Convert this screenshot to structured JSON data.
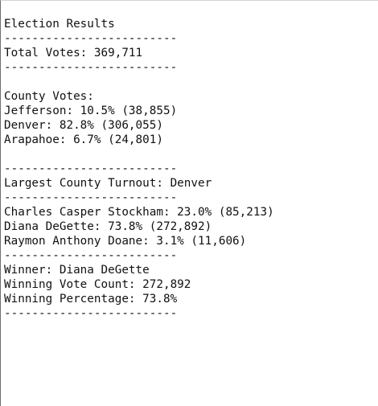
{
  "document": {
    "title": "Election Results",
    "separator": "-------------------------",
    "total_votes": "Total Votes: 369,711",
    "county_header": "County Votes:",
    "counties": [
      "Jefferson: 10.5% (38,855)",
      "Denver: 82.8% (306,055)",
      "Arapahoe: 6.7% (24,801)"
    ],
    "largest_county": "Largest County Turnout: Denver",
    "candidates": [
      "Charles Casper Stockham: 23.0% (85,213)",
      "Diana DeGette: 73.8% (272,892)",
      "Raymon Anthony Doane: 3.1% (11,606)"
    ],
    "winner": "Winner: Diana DeGette",
    "winning_count": "Winning Vote Count: 272,892",
    "winning_percentage": "Winning Percentage: 73.8%"
  }
}
